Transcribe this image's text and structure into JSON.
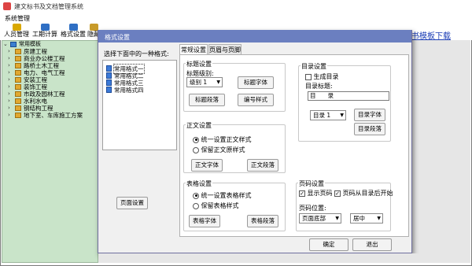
{
  "window": {
    "title": "建文标书及文档管理系统"
  },
  "menubar": {
    "system": "系统管理"
  },
  "toolbar": {
    "items": [
      {
        "label": "人员管理",
        "icon": "person-icon",
        "color": "#d9a800"
      },
      {
        "label": "工期计算",
        "icon": "calculator-icon",
        "color": "#2f6fc4"
      },
      {
        "label": "格式设置",
        "icon": "format-icon",
        "color": "#2f6fc4"
      },
      {
        "label": "隐藏",
        "icon": "hide-icon",
        "color": "#c89b2a"
      }
    ],
    "download_link": "标书模板下载"
  },
  "tree": {
    "root": "常用模板",
    "items": [
      "房建工程",
      "商业办公楼工程",
      "路桥土木工程",
      "电力、电气工程",
      "安装工程",
      "装饰工程",
      "市政及园林工程",
      "水利水电",
      "钢结构工程",
      "地下室、车库施工方案"
    ]
  },
  "dialog": {
    "title": "格式设置",
    "choose_label": "选择下面中的一种格式:",
    "formats": [
      "常用格式一",
      "常用格式二",
      "常用格式三",
      "常用格式四"
    ],
    "page_setup": "页面设置",
    "tabs": [
      "常规设置",
      "页眉与页脚"
    ],
    "heading": {
      "group": "标题设置",
      "level_label": "标题级别:",
      "level_value": "级别 1",
      "font_button": "标题字体",
      "para_button": "标题段落",
      "number_button": "编号样式"
    },
    "body": {
      "group": "正文设置",
      "option_unified": "统一设置正文样式",
      "option_keep": "保留正文原样式",
      "font_button": "正文字体",
      "para_button": "正文段落"
    },
    "table": {
      "group": "表格设置",
      "option_unified": "统一设置表格样式",
      "option_keep": "保留表格样式",
      "font_button": "表格字体",
      "para_button": "表格段落"
    },
    "toc": {
      "group": "目录设置",
      "generate": "生成目录",
      "title_label": "目录标题:",
      "title_value": "目　　录",
      "level_value": "目录 1",
      "font_button": "目录字体",
      "para_button": "目录段落"
    },
    "page_number": {
      "group": "页码设置",
      "show": "显示页码",
      "from_toc": "页码从目录后开始",
      "position_label": "页码位置:",
      "position_value": "页面底部",
      "align_value": "居中"
    },
    "ok": "确定",
    "exit": "退出"
  }
}
